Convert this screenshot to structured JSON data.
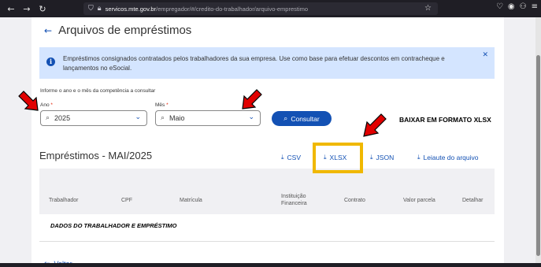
{
  "browser": {
    "url_host": "servicos.mte.gov.br",
    "url_path": "/empregador/#/credito-do-trabalhador/arquivo-emprestimo"
  },
  "page": {
    "title": "Arquivos de empréstimos",
    "alert_text": "Empréstimos consignados contratados pelos trabalhadores da sua empresa. Use como base para efetuar descontos em contracheque e lançamentos no eSocial.",
    "form_label": "Informe o ano e o mês da competência a consultar",
    "ano_label": "Ano",
    "ano_value": "2025",
    "mes_label": "Mês",
    "mes_value": "Maio",
    "consultar_label": "Consultar",
    "table_title": "Empréstimos - MAI/2025",
    "downloads": {
      "csv": "CSV",
      "xlsx": "XLSX",
      "json": "JSON",
      "leiaute": "Leiaute do arquivo"
    },
    "columns": {
      "trabalhador": "Trabalhador",
      "cpf": "CPF",
      "matricula": "Matrícula",
      "instituicao": "Instituição Financeira",
      "contrato": "Contrato",
      "valor": "Valor parcela",
      "detalhar": "Detalhar"
    },
    "row_placeholder": "DADOS DO TRABALHADOR E EMPRÉSTIMO",
    "voltar_label": "Voltar"
  },
  "annotation": {
    "callout": "BAIXAR EM FORMATO XLSX",
    "highlight_color": "#f0b800",
    "arrow_color": "#e10000"
  },
  "colors": {
    "primary": "#1351b4",
    "alert_bg": "#d4e5ff",
    "table_header_bg": "#f0f0f3"
  }
}
